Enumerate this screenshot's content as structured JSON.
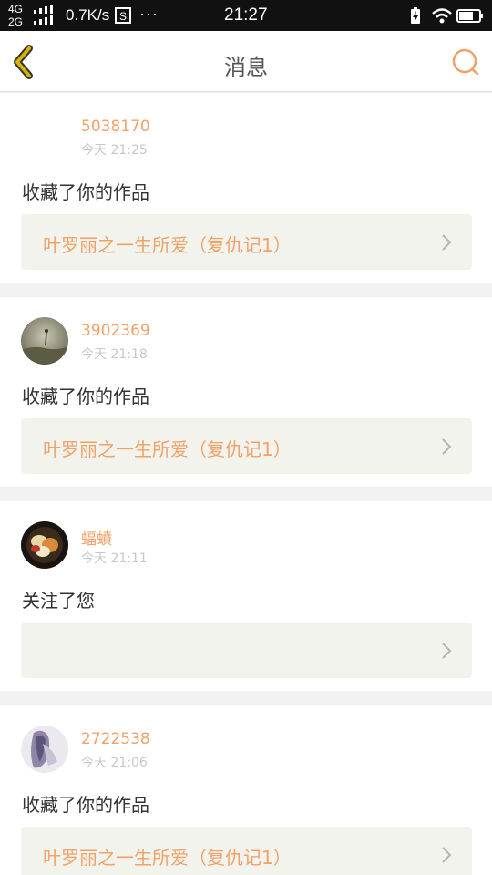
{
  "status_bar": {
    "network_top": "4G",
    "network_bottom": "2G",
    "speed": "0.7K/s",
    "dots": "···",
    "time": "21:27"
  },
  "header": {
    "title": "消息",
    "back_icon": "chevron-left-icon",
    "search_icon": "search-icon"
  },
  "colors": {
    "accent": "#f0a268",
    "back_arrow": "#d6b400",
    "card_link_bg": "#f3f3ed"
  },
  "messages": [
    {
      "username": "5038170",
      "time": "今天 21:25",
      "action": "收藏了你的作品",
      "work_title": "叶罗丽之一生所爱（复仇记1）",
      "avatar": "blank"
    },
    {
      "username": "3902369",
      "time": "今天 21:18",
      "action": "收藏了你的作品",
      "work_title": "叶罗丽之一生所爱（复仇记1）",
      "avatar": "landscape"
    },
    {
      "username": "蝠蟦",
      "time": "今天 21:11",
      "action": "关注了您",
      "work_title": "",
      "avatar": "food"
    },
    {
      "username": "2722538",
      "time": "今天 21:06",
      "action": "收藏了你的作品",
      "work_title": "叶罗丽之一生所爱（复仇记1）",
      "avatar": "girl"
    }
  ]
}
